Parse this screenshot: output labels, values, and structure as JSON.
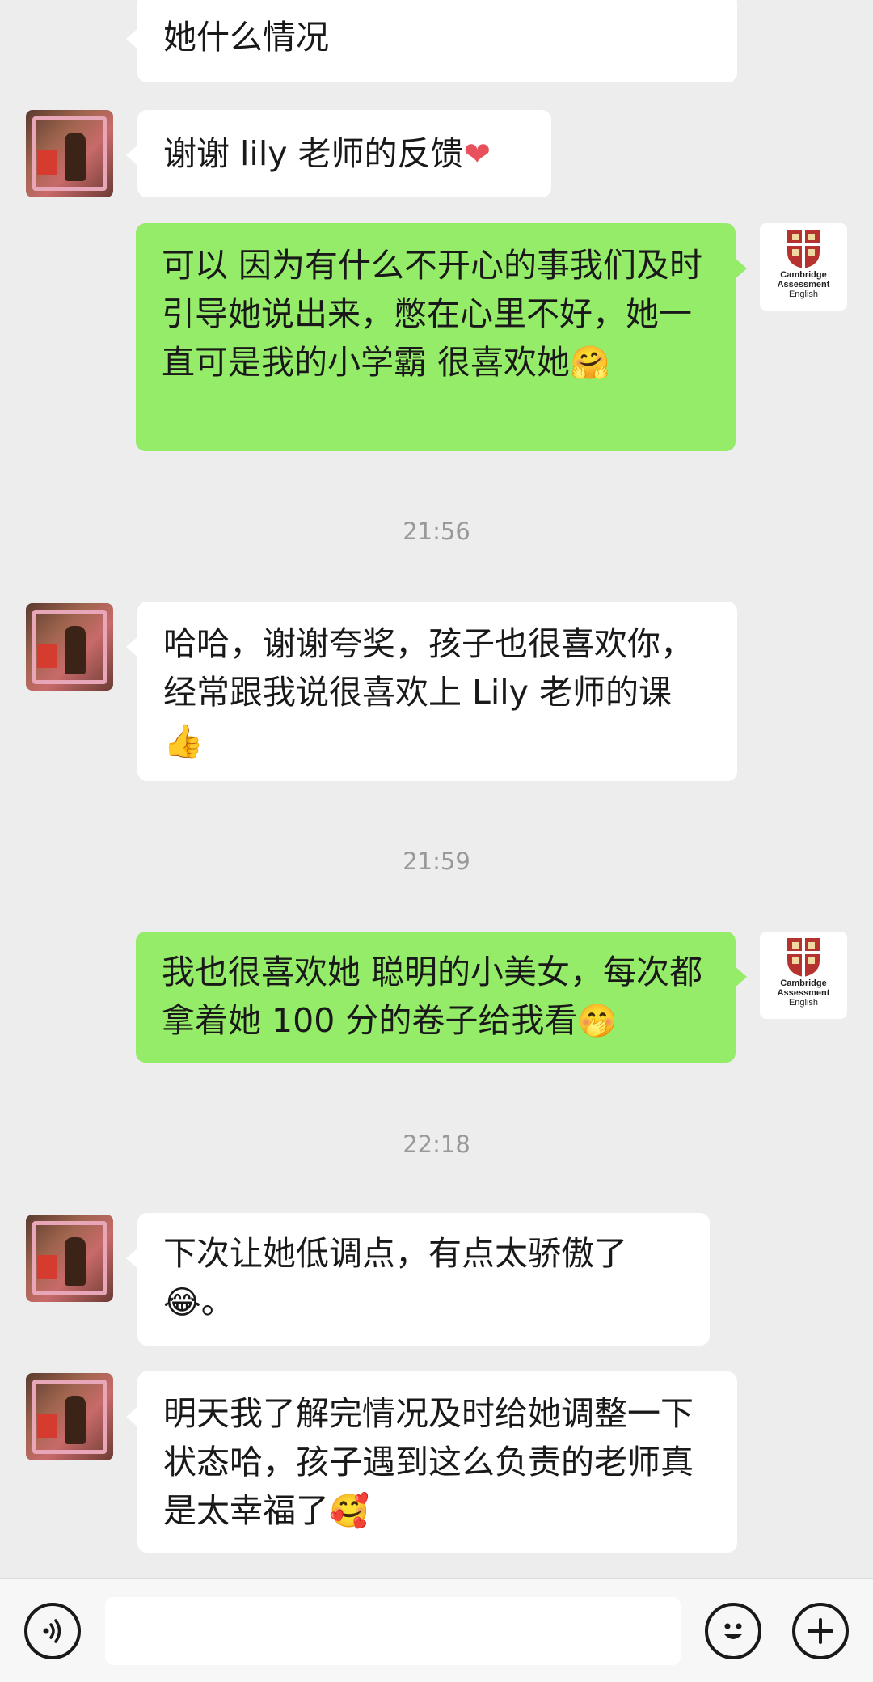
{
  "messages": [
    {
      "side": "left",
      "text": "她什么情况",
      "emoji": ""
    },
    {
      "side": "left",
      "text": "谢谢 lily 老师的反馈",
      "emoji": "❤"
    },
    {
      "side": "right",
      "text": "可以 因为有什么不开心的事我们及时引导她说出来，憋在心里不好，她一直可是我的小学霸 很喜欢她",
      "emoji": "🤗"
    },
    {
      "side": "left",
      "text": "哈哈，谢谢夸奖，孩子也很喜欢你，经常跟我说很喜欢上 Lily 老师的课",
      "emoji": "👍"
    },
    {
      "side": "right",
      "text": "我也很喜欢她 聪明的小美女，每次都拿着她 100 分的卷子给我看",
      "emoji": "🤭"
    },
    {
      "side": "left",
      "text": "下次让她低调点，有点太骄傲了",
      "emoji": "😂",
      "after_emoji": "。"
    },
    {
      "side": "left",
      "text": "明天我了解完情况及时给她调整一下状态哈，孩子遇到这么负责的老师真是太幸福了",
      "emoji": "🥰"
    }
  ],
  "timestamps": [
    "21:56",
    "21:59",
    "22:18"
  ],
  "self_avatar_logo": [
    "Cambridge",
    "Assessment",
    "English"
  ],
  "input_bar": {
    "voice_icon": "voice-icon",
    "emoji_icon": "emoji-icon",
    "plus_icon": "plus-icon",
    "input_value": ""
  },
  "colors": {
    "background": "#ededed",
    "self_bubble": "#95ec69",
    "other_bubble": "#ffffff",
    "timestamp": "#999999"
  }
}
